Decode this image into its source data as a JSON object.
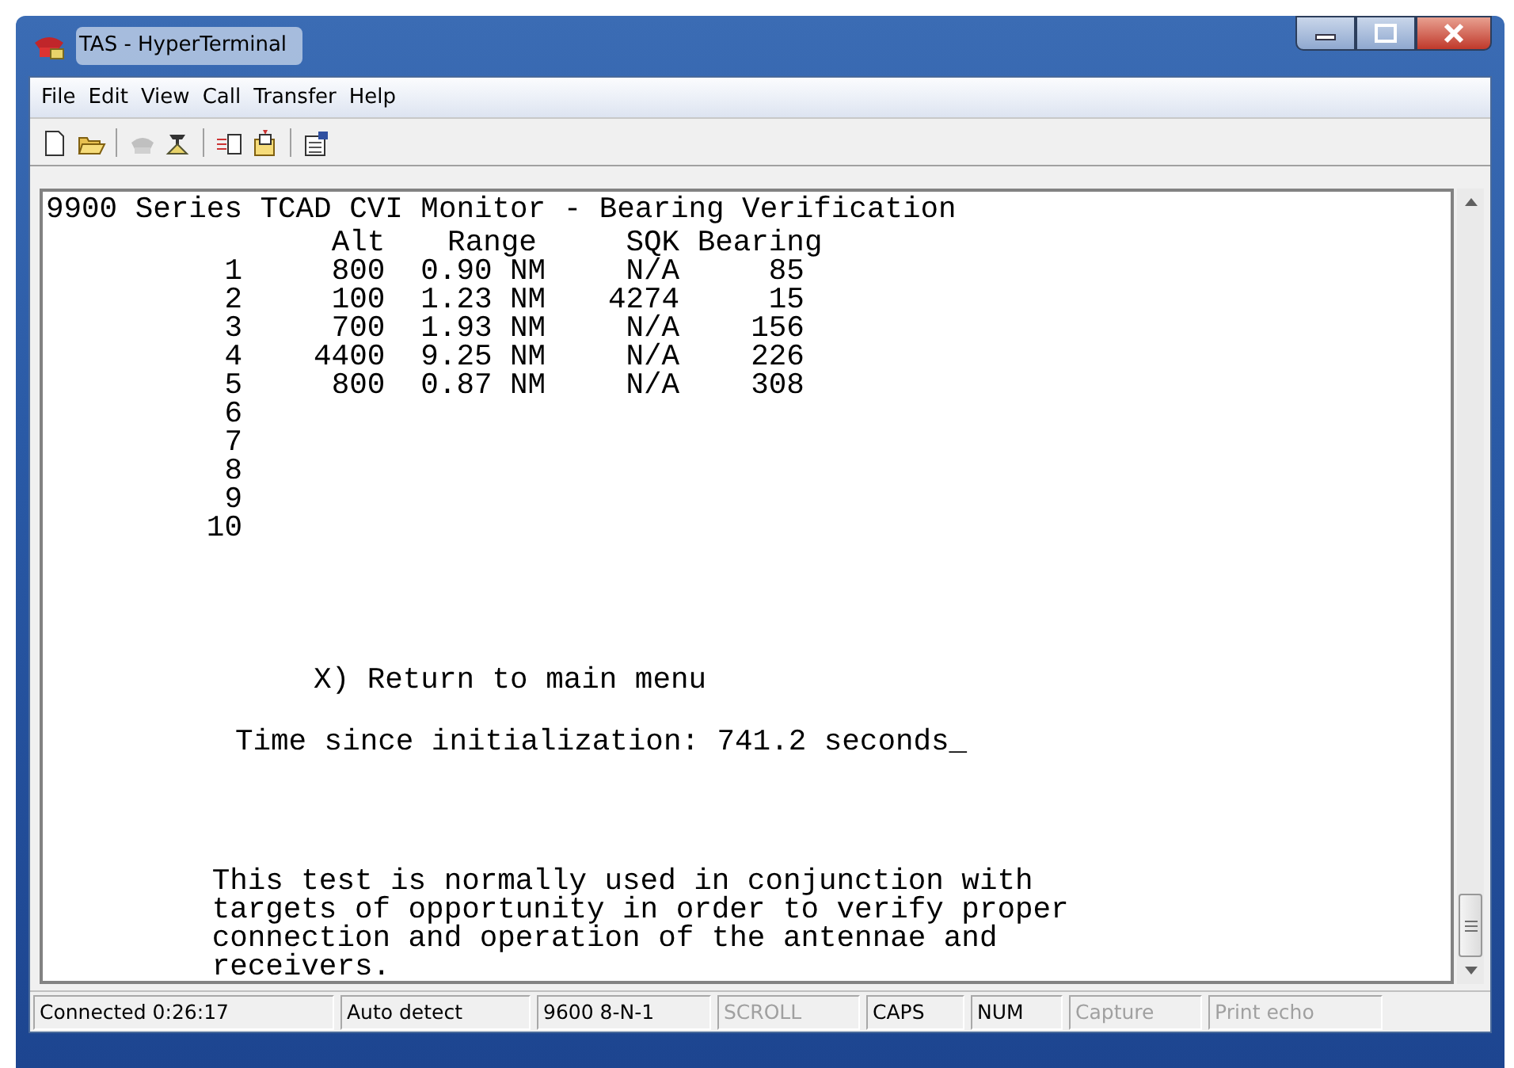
{
  "window": {
    "title": "TAS - HyperTerminal"
  },
  "menu": [
    "File",
    "Edit",
    "View",
    "Call",
    "Transfer",
    "Help"
  ],
  "toolbar": [
    {
      "kind": "new",
      "disabled": false
    },
    {
      "kind": "open",
      "disabled": false
    },
    {
      "kind": "separator"
    },
    {
      "kind": "disconnect",
      "disabled": true
    },
    {
      "kind": "dial",
      "disabled": false
    },
    {
      "kind": "separator"
    },
    {
      "kind": "send",
      "disabled": false
    },
    {
      "kind": "receive",
      "disabled": false
    },
    {
      "kind": "separator"
    },
    {
      "kind": "properties",
      "disabled": false
    }
  ],
  "terminal": {
    "heading": "9900 Series TCAD CVI Monitor - Bearing Verification",
    "table": {
      "columns": [
        "Alt",
        "Range",
        "SQK",
        "Bearing"
      ],
      "rows": [
        {
          "number": "1",
          "alt": "800",
          "range": "0.90 NM",
          "sqk": "N/A",
          "bearing": "85"
        },
        {
          "number": "2",
          "alt": "100",
          "range": "1.23 NM",
          "sqk": "4274",
          "bearing": "15"
        },
        {
          "number": "3",
          "alt": "700",
          "range": "1.93 NM",
          "sqk": "N/A",
          "bearing": "156"
        },
        {
          "number": "4",
          "alt": "4400",
          "range": "9.25 NM",
          "sqk": "N/A",
          "bearing": "226"
        },
        {
          "number": "5",
          "alt": "800",
          "range": "0.87 NM",
          "sqk": "N/A",
          "bearing": "308"
        },
        {
          "number": "6"
        },
        {
          "number": "7"
        },
        {
          "number": "8"
        },
        {
          "number": "9"
        },
        {
          "number": "10"
        }
      ]
    },
    "menu_option": "X) Return to main menu",
    "status_line": "Time since initialization: 741.2 seconds_",
    "description": [
      "This test is normally used in conjunction with",
      "targets of opportunity in order to verify proper",
      "connection and operation of the antennae and",
      "receivers."
    ]
  },
  "status_bar": [
    {
      "text": "Connected 0:26:17",
      "active": true
    },
    {
      "text": "Auto detect",
      "active": true
    },
    {
      "text": "9600 8-N-1",
      "active": true
    },
    {
      "text": "SCROLL",
      "active": false
    },
    {
      "text": "CAPS",
      "active": true
    },
    {
      "text": "NUM",
      "active": true
    },
    {
      "text": "Capture",
      "active": false
    },
    {
      "text": "Print echo",
      "active": false
    }
  ]
}
